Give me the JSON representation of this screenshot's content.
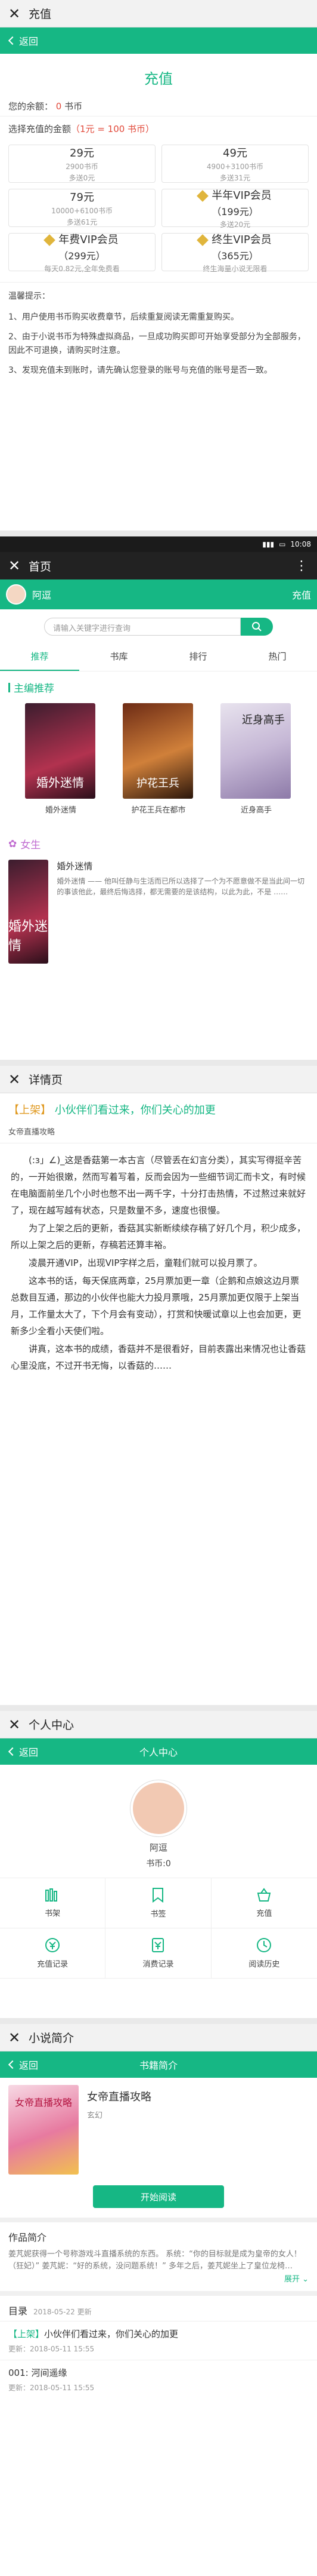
{
  "accent_color": "#16b784",
  "recharge": {
    "wx_title": "充值",
    "back_label": "返回",
    "page_title": "充值",
    "balance_label": "您的余额：",
    "balance_value": "0",
    "balance_unit": "书币",
    "choose_label": "选择充值的金额",
    "rate_label": "（1元 = 100 书币）",
    "options": [
      {
        "amount": "29元",
        "coins": "2900书币",
        "bonus": "多送0元"
      },
      {
        "amount": "49元",
        "coins": "4900+3100书币",
        "bonus": "多送31元"
      },
      {
        "amount": "79元",
        "coins": "10000+6100书币",
        "bonus": "多送61元"
      },
      {
        "amount": "半年VIP会员",
        "coins": "（199元）",
        "bonus": "多送20元"
      },
      {
        "amount": "年费VIP会员",
        "coins": "（299元）",
        "bonus": "每天0.82元,全年免费看"
      },
      {
        "amount": "终生VIP会员",
        "coins": "（365元）",
        "bonus": "终生海量小说无限看"
      }
    ],
    "tips_title": "温馨提示：",
    "tips": [
      "1、用户使用书币购买收费章节，后续重复阅读无需重复购买。",
      "2、由于小说书币为特殊虚拟商品，一旦成功购买即可开始享受部分为全部服务，因此不可退换，请购买时注意。",
      "3、发现充值未到账时，请先确认您登录的账号与充值的账号是否一致。"
    ]
  },
  "home": {
    "wx_title": "首页",
    "status_time": "10:08",
    "username": "阿逗",
    "recharge_link": "充值",
    "search_placeholder": "请输入关键字进行查询",
    "tabs": [
      "推荐",
      "书库",
      "排行",
      "热门"
    ],
    "section_recommend": "主编推荐",
    "books": [
      {
        "title": "婚外迷情",
        "cover_text": "婚外迷情"
      },
      {
        "title": "护花王兵在都市",
        "cover_text": "护花王兵"
      },
      {
        "title": "近身高手",
        "cover_text": "近身高手"
      }
    ],
    "section_girl": "女生",
    "girl_book": {
      "title": "婚外迷情",
      "desc": "婚外迷情 —— 他叫任静与生活而已所以选择了一个为不愿意做不是当此间一切的事该他此，最终后悔选择，都无需要的是该结构，以此为此，不是 ……",
      "cover_text": "婚外迷情"
    }
  },
  "detail": {
    "wx_title": "详情页",
    "headline_tag": "【上架】",
    "headline_text": "小伙伴们看过来，你们关心的加更",
    "book_name": "女帝直播攻略",
    "paragraphs": [
      "(:з」∠)_这是香菇第一本古言（尽管丢在幻言分类），其实写得挺辛苦的，一开始很嫩，然而写着写着，反而会因为一些细节词汇而卡文，有时候在电脑面前坐几个小时也憋不出一两千字，十分打击热情，不过熬过来就好了，现在越写越有状态，只是数量不多，速度也很慢。",
      "为了上架之后的更新，香菇其实新断续续存稿了好几个月，积少成多，所以上架之后的更新，存稿若还算丰裕。",
      "凌晨开通VIP，出现VIP字样之后，童鞋们就可以投月票了。",
      "这本书的话，每天保底两章，25月票加更一章（企鹅和点娘这边月票总数目互通，那边的小伙伴也能大力投月票哦，25月票加更仅限于上架当月，工作量太大了，下个月会有变动），打赏和快暖试章以上也会加更，更新多少全看小天使们啦。",
      "讲真，这本书的成绩，香菇并不是很看好，目前表露出来情况也让香菇心里没底，不过开书无悔，以香菇的……"
    ]
  },
  "profile": {
    "wx_title": "个人中心",
    "back_label": "返回",
    "header_title": "个人中心",
    "username": "阿逗",
    "coins": "书币:0",
    "items": [
      {
        "label": "书架",
        "icon": "bookshelf-icon"
      },
      {
        "label": "书签",
        "icon": "bookmark-icon"
      },
      {
        "label": "充值",
        "icon": "recharge-icon"
      },
      {
        "label": "充值记录",
        "icon": "recharge-record-icon"
      },
      {
        "label": "消费记录",
        "icon": "consume-record-icon"
      },
      {
        "label": "阅读历史",
        "icon": "history-icon"
      }
    ]
  },
  "bookinfo": {
    "wx_title": "小说简介",
    "back_label": "返回",
    "header_title": "书籍简介",
    "title": "女帝直播攻略",
    "author": "玄幻",
    "cover_text": "女帝直播攻略",
    "read_button": "开始阅读",
    "intro_title": "作品简介",
    "intro_text": "姜芃妮获得一个号称游戏斗直播系统的东西。 系统：“你的目标就是成为皇帝的女人！（狂妃）” 姜芃妮：“好的系统，没问题系统！” 多年之后，姜芃妮坐上了皇位龙椅…",
    "expand": "展开",
    "toc_title": "目录",
    "toc_date": "2018-05-22 更新",
    "chapters": [
      {
        "name_tag": "【上架】",
        "name": "小伙伴们看过来，你们关心的加更",
        "date": "更新：2018-05-11 15:55"
      },
      {
        "name_tag": "",
        "name": "001: 河间遥缘",
        "date": "更新：2018-05-11 15:55"
      }
    ]
  }
}
